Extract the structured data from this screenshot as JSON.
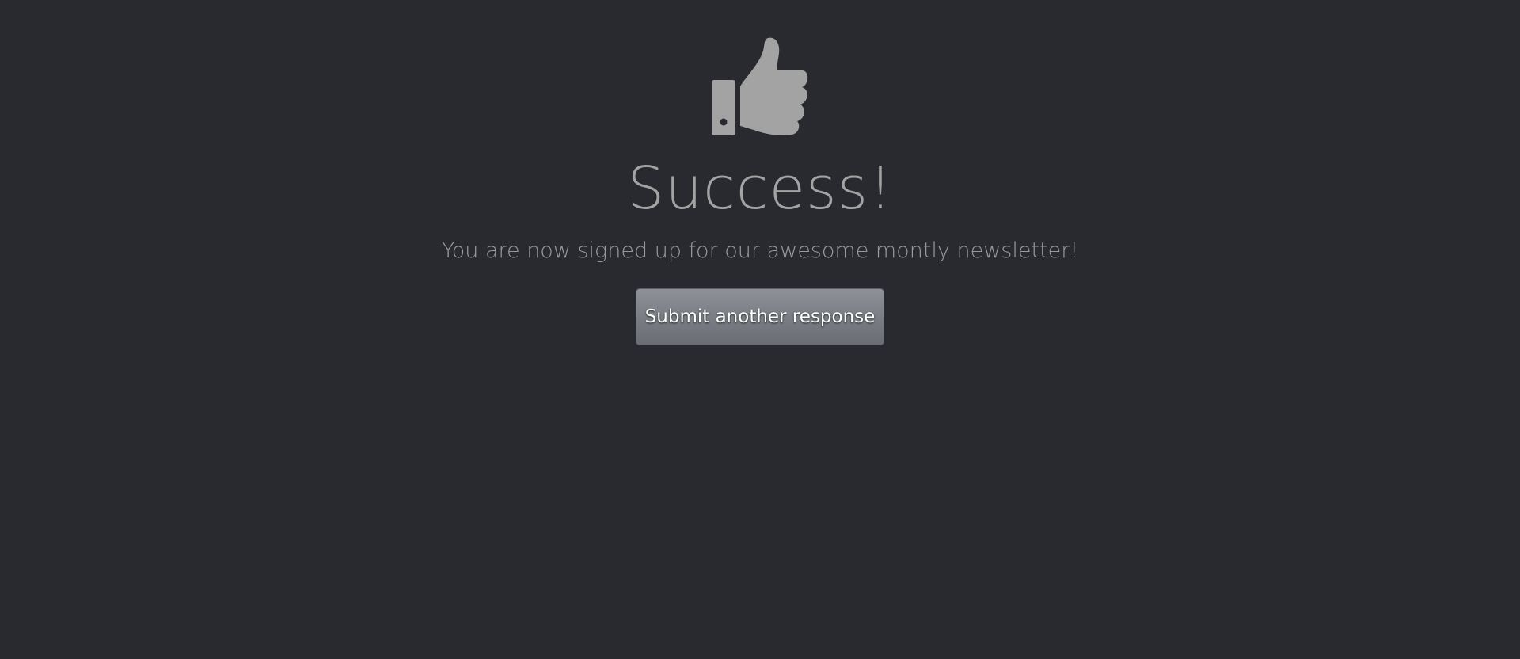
{
  "icon": {
    "name": "thumbs-up-icon",
    "color": "#a3a3a3"
  },
  "heading": "Success!",
  "message": "You are now signed up for our awesome montly newsletter!",
  "button": {
    "label": "Submit another response"
  },
  "colors": {
    "background": "#282a2f",
    "text": "#a3a3a3",
    "button_top": "#8e9197",
    "button_bottom": "#6a6d74",
    "button_text": "#ffffff"
  }
}
